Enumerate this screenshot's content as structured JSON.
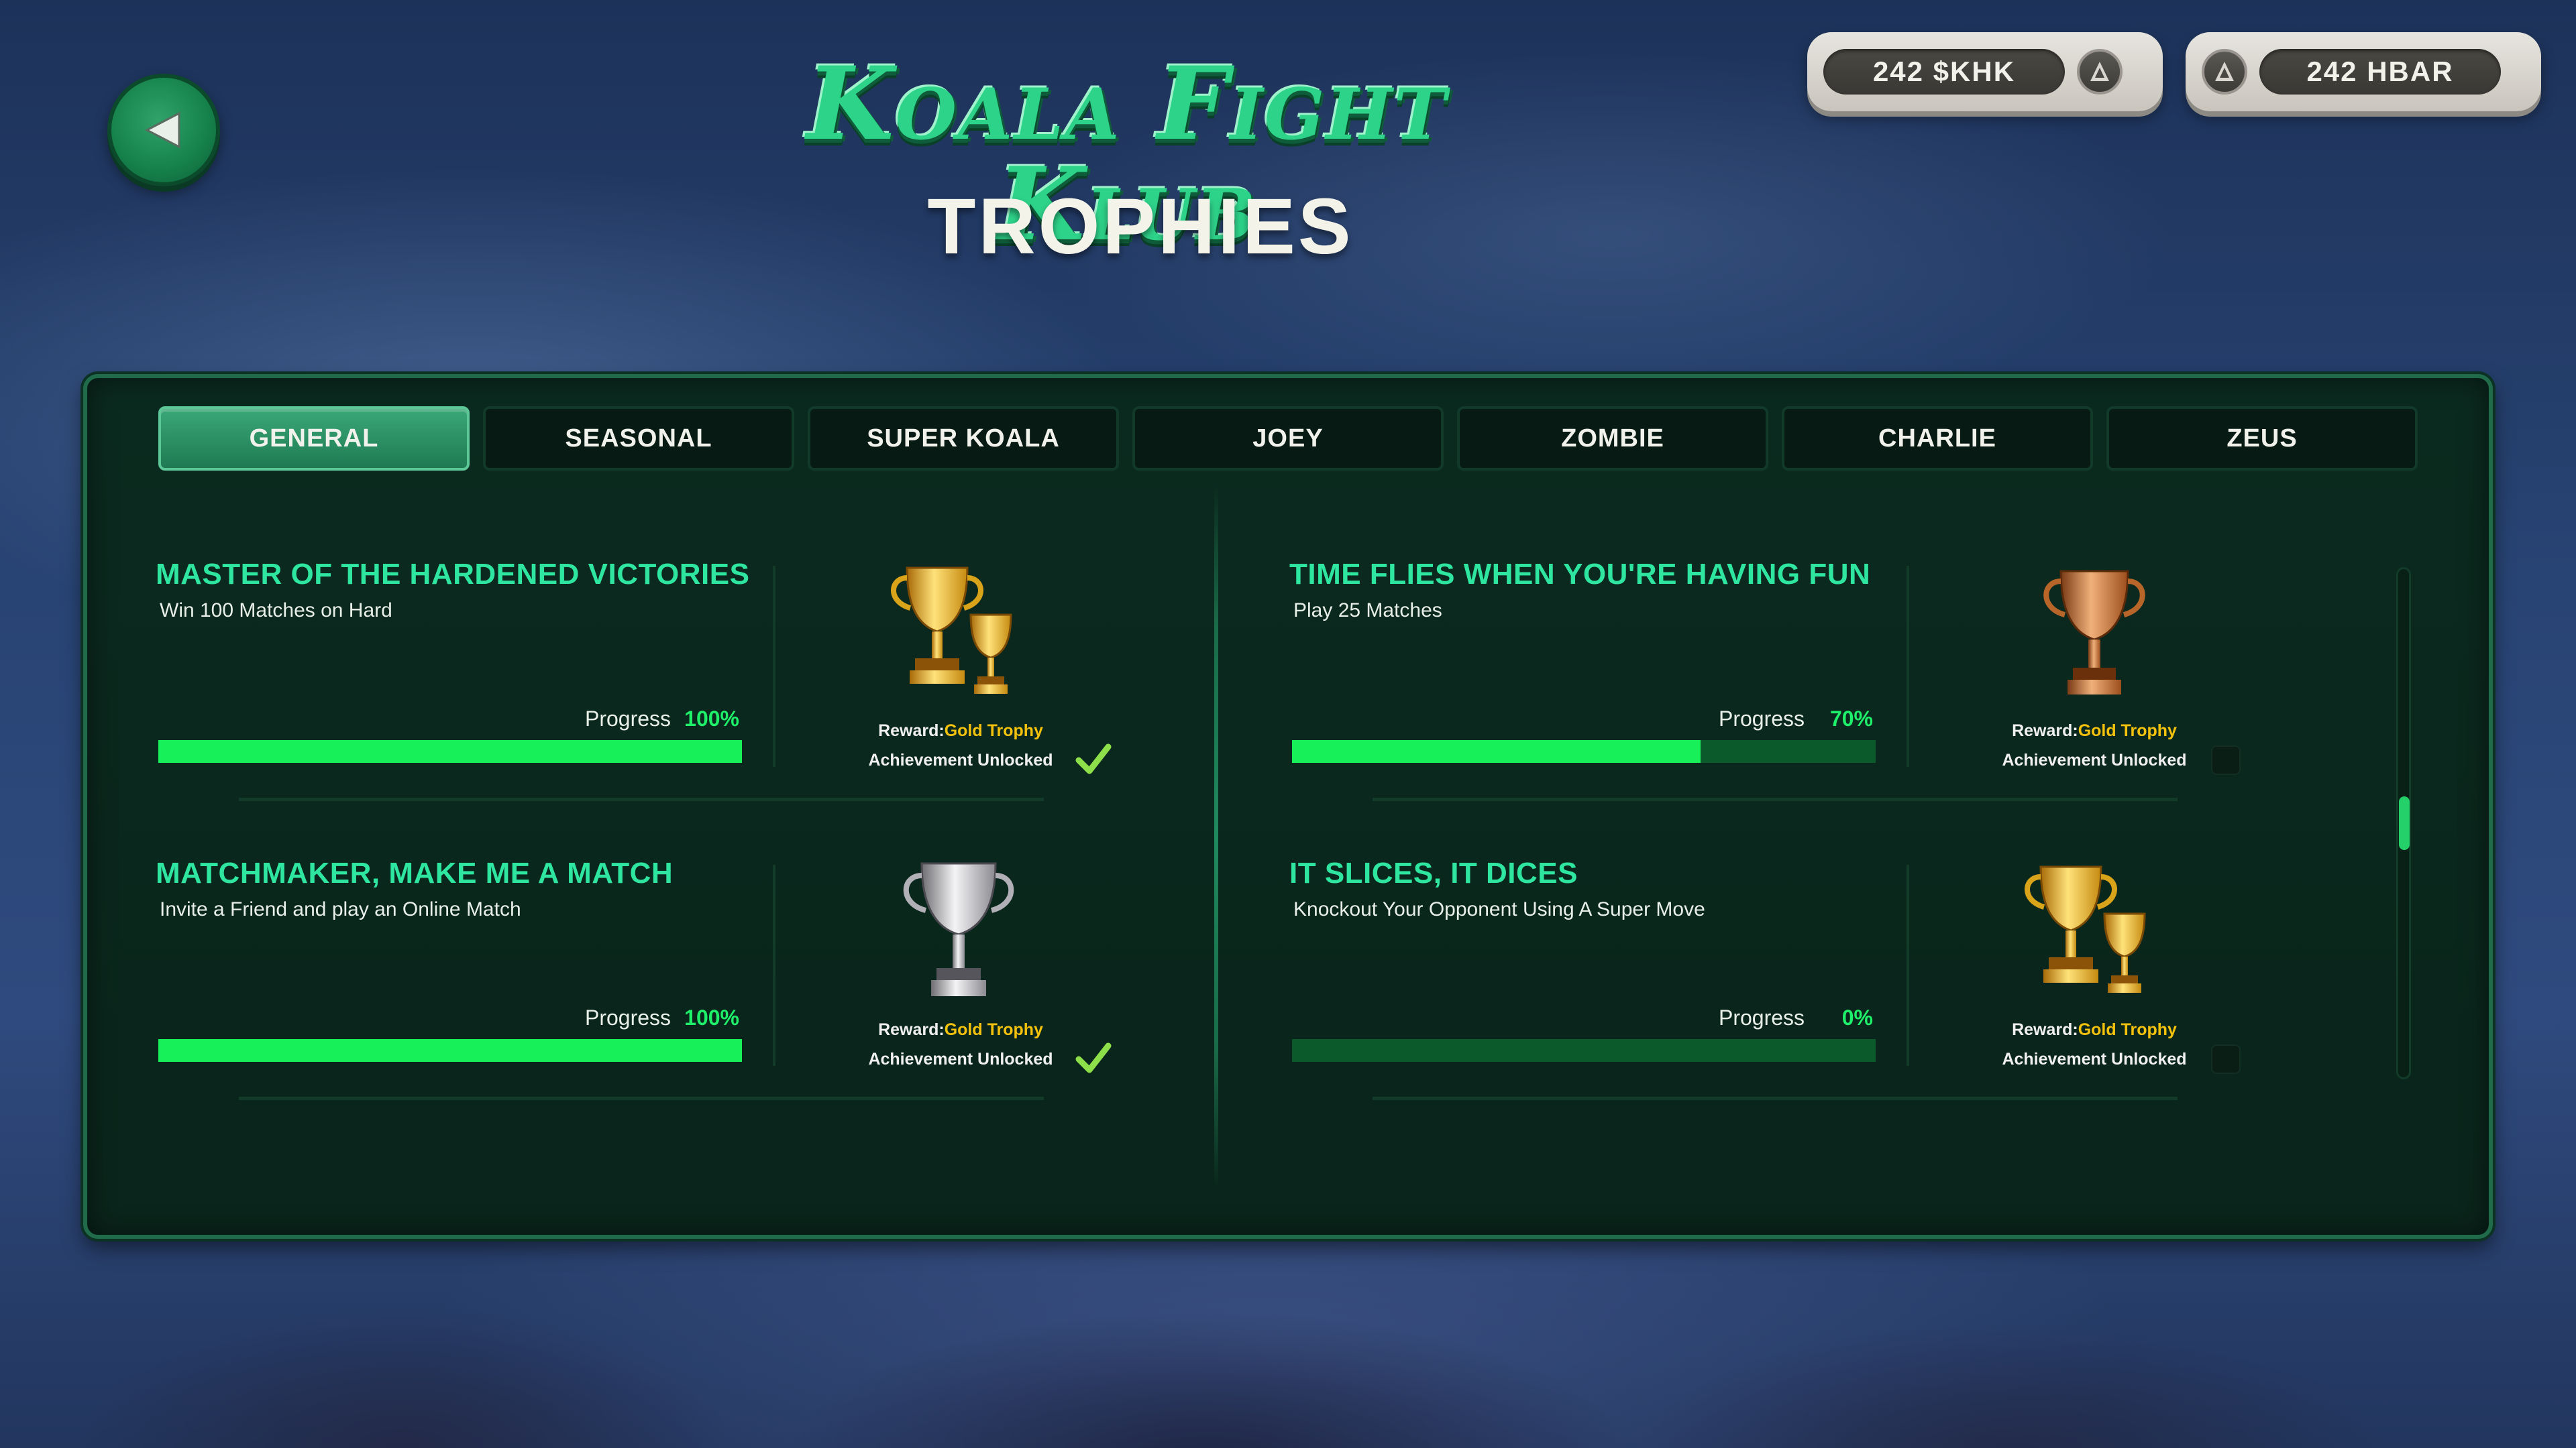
{
  "header": {
    "logo_text": "Koala Fight Klub",
    "page_title": "TROPHIES"
  },
  "back_icon": "back-arrow-icon",
  "currencies": [
    {
      "amount": "242 $KHK",
      "icon": "hbar-coin-icon"
    },
    {
      "amount": "242 HBAR",
      "icon": "hbar-coin-icon"
    }
  ],
  "tabs": [
    {
      "label": "GENERAL",
      "active": true
    },
    {
      "label": "SEASONAL",
      "active": false
    },
    {
      "label": "SUPER KOALA",
      "active": false
    },
    {
      "label": "JOEY",
      "active": false
    },
    {
      "label": "ZOMBIE",
      "active": false
    },
    {
      "label": "CHARLIE",
      "active": false
    },
    {
      "label": "ZEUS",
      "active": false
    }
  ],
  "achievements": [
    {
      "title": "MASTER OF THE HARDENED VICTORIES",
      "description": "Win 100 Matches on Hard",
      "progress_label": "Progress",
      "progress_value": "100%",
      "progress": 1.0,
      "reward_label": "Reward:",
      "reward_value": "Gold Trophy",
      "status": "Achievement Unlocked",
      "trophy": "gold-double-trophy-icon",
      "completed": true
    },
    {
      "title": "TIME FLIES WHEN YOU'RE HAVING FUN",
      "description": "Play 25 Matches",
      "progress_label": "Progress",
      "progress_value": "70%",
      "progress": 0.7,
      "reward_label": "Reward:",
      "reward_value": "Gold Trophy",
      "status": "Achievement Unlocked",
      "trophy": "bronze-trophy-icon",
      "completed": false
    },
    {
      "title": "MATCHMAKER, MAKE ME A MATCH",
      "description": "Invite a Friend and play an Online Match",
      "progress_label": "Progress",
      "progress_value": "100%",
      "progress": 1.0,
      "reward_label": "Reward:",
      "reward_value": "Gold Trophy",
      "status": "Achievement Unlocked",
      "trophy": "silver-trophy-icon",
      "completed": true
    },
    {
      "title": "IT SLICES, IT DICES",
      "description": "Knockout Your Opponent Using A Super Move",
      "progress_label": "Progress",
      "progress_value": "0%",
      "progress": 0.0,
      "reward_label": "Reward:",
      "reward_value": "Gold Trophy",
      "status": "Achievement Unlocked",
      "trophy": "gold-double-trophy-icon",
      "completed": false
    }
  ],
  "colors": {
    "accent_green": "#2ee6a0",
    "progress_green": "#18f05a",
    "reward_gold": "#f4c20d"
  }
}
